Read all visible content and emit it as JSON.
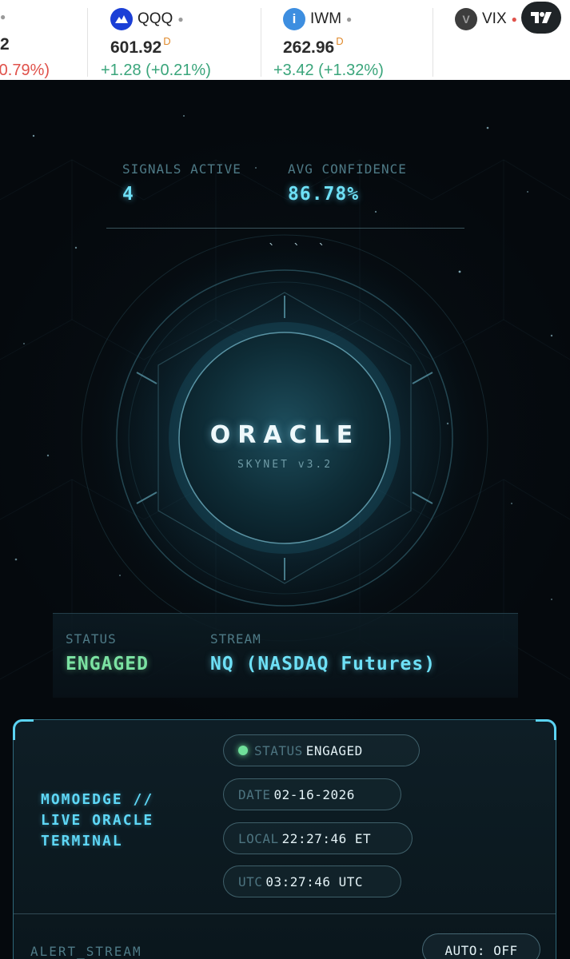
{
  "ticker": {
    "items": [
      {
        "symbol": "",
        "price": "",
        "change": "0.79%)",
        "change_color": "#e0524b",
        "logo": ""
      },
      {
        "symbol": "QQQ",
        "price": "601.92",
        "flag": "D",
        "change": "+1.28 (+0.21%)",
        "change_color": "#3aa57b",
        "logo": "mountain-icon",
        "logo_color": "#1b3fd6"
      },
      {
        "symbol": "IWM",
        "price": "262.96",
        "flag": "D",
        "change": "+3.42 (+1.32%)",
        "change_color": "#3aa57b",
        "logo": "i",
        "logo_color": "#3d8ee0"
      },
      {
        "symbol": "VIX",
        "logo": "V",
        "logo_color": "#3d3d3d"
      }
    ],
    "partial_price": "2",
    "tv_icon": "tradingview-icon"
  },
  "signals": {
    "active_label": "SIGNALS ACTIVE",
    "active_value": "4",
    "confidence_label": "AVG CONFIDENCE",
    "confidence_value": "86.78%"
  },
  "core": {
    "title": "ORACLE",
    "subtitle": "SKYNET v3.2",
    "ticks": "` ` `"
  },
  "status": {
    "status_label": "STATUS",
    "status_value": "ENGAGED",
    "status_color": "#7be2a2",
    "stream_label": "STREAM",
    "stream_value": "NQ (NASDAQ Futures)",
    "stream_color": "#6ee0f6"
  },
  "terminal": {
    "title": "MOMOEDGE //\nLIVE ORACLE\nTERMINAL",
    "pills": {
      "status": {
        "key": "STATUS",
        "value": "ENGAGED"
      },
      "date": {
        "key": "DATE",
        "value": "02-16-2026"
      },
      "local": {
        "key": "LOCAL",
        "value": "22:27:46 ET"
      },
      "utc": {
        "key": "UTC",
        "value": "03:27:46 UTC"
      }
    },
    "alert_label": "ALERT_STREAM",
    "auto_label": "AUTO: OFF"
  },
  "colors": {
    "accent": "#6ee0f6",
    "engaged": "#7be2a2",
    "negative": "#e0524b",
    "positive": "#3aa57b"
  }
}
